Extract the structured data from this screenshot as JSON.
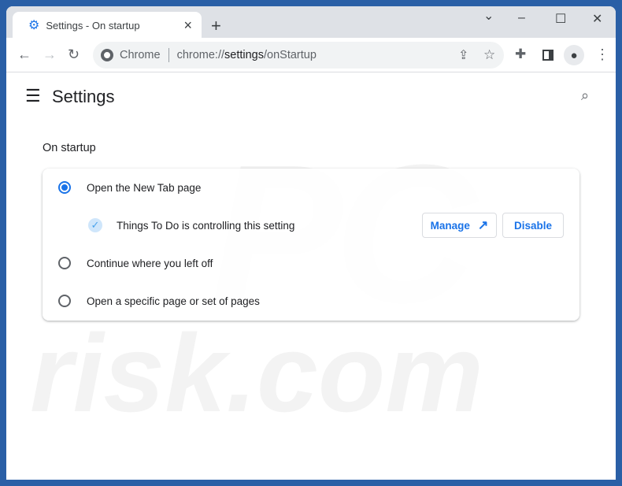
{
  "tab": {
    "title": "Settings - On startup",
    "close": "×",
    "new_tab": "+"
  },
  "window": {
    "dropdown": "⌄",
    "minimize": "–",
    "maximize": "☐",
    "close": "✕"
  },
  "omnibox": {
    "site": "Chrome",
    "url_prefix": "chrome://",
    "url_host": "settings",
    "url_path": "/onStartup"
  },
  "page": {
    "title": "Settings",
    "section": "On startup"
  },
  "options": [
    {
      "label": "Open the New Tab page",
      "selected": true
    },
    {
      "label": "Continue where you left off",
      "selected": false
    },
    {
      "label": "Open a specific page or set of pages",
      "selected": false
    }
  ],
  "extension": {
    "text": "Things To Do is controlling this setting",
    "manage": "Manage",
    "disable": "Disable"
  },
  "colors": {
    "accent": "#1a73e8",
    "frame": "#2a5fa6"
  }
}
